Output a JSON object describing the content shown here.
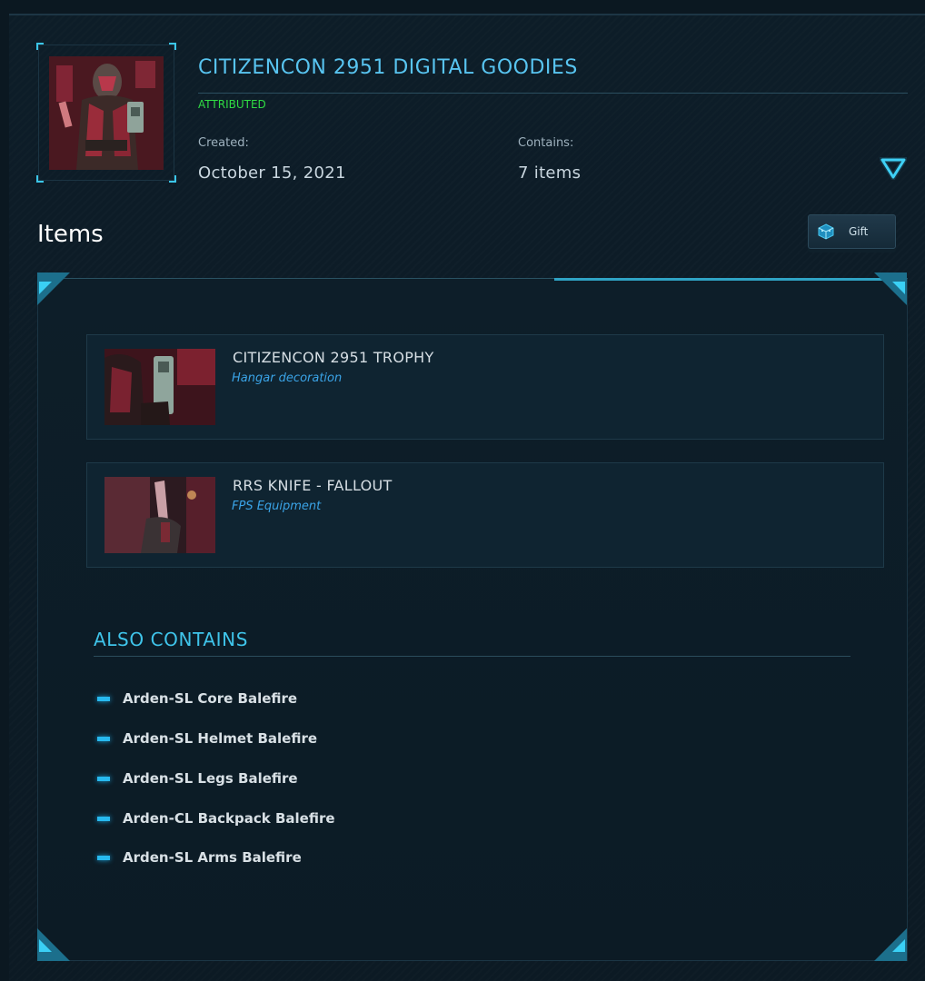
{
  "pledge": {
    "title": "CITIZENCON 2951 DIGITAL GOODIES",
    "status": "ATTRIBUTED",
    "created_label": "Created:",
    "created_value": "October 15, 2021",
    "contains_label": "Contains:",
    "contains_value": "7 items"
  },
  "items_section": {
    "heading": "Items",
    "gift_label": "Gift"
  },
  "items": [
    {
      "name": "CITIZENCON 2951 TROPHY",
      "type": "Hangar decoration"
    },
    {
      "name": "RRS KNIFE - FALLOUT",
      "type": "FPS Equipment"
    }
  ],
  "also_contains": {
    "heading": "ALSO CONTAINS",
    "entries": [
      "Arden-SL Core Balefire",
      "Arden-SL Helmet Balefire",
      "Arden-SL Legs Balefire",
      "Arden-CL Backpack Balefire",
      "Arden-SL Arms Balefire"
    ]
  },
  "icons": {
    "expand": "chevron-down-icon",
    "gift": "gift-box-icon"
  },
  "colors": {
    "accent": "#3bc6e8",
    "title": "#58c4f0",
    "status": "#2fdc43",
    "item_type": "#3aa3e6"
  }
}
